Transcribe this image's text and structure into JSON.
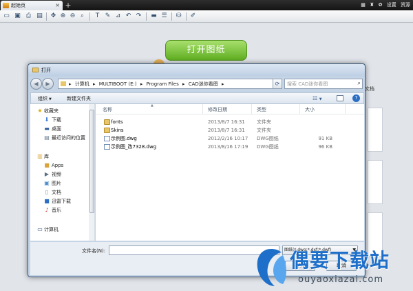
{
  "tabs": [
    {
      "label": "起始页",
      "close": "×"
    }
  ],
  "tab_add": "+",
  "topbar": {
    "settings": "设置",
    "resources": "资源"
  },
  "toolbar": {
    "icons": [
      "open-file-icon",
      "save-icon",
      "print-icon",
      "print-preview-icon",
      "zoom-realtime-icon",
      "zoom-in-icon",
      "zoom-out-icon",
      "zoom-extents-icon",
      "text-icon",
      "pen-icon",
      "measure-icon",
      "undo-icon",
      "redo-icon",
      "layer-icon",
      "layers-icon",
      "layer-manager-icon",
      "paint-icon"
    ]
  },
  "workspace": {
    "open_drawing": "打开图纸",
    "recent_doc": "文档"
  },
  "dialog": {
    "title": "打开",
    "back": "◀",
    "forward": "▶",
    "path": [
      "计算机",
      "MULTIBOOT (E:)",
      "Program Files",
      "CAD迷你看图"
    ],
    "search_placeholder": "搜索 CAD迷你看图",
    "organize": "组织",
    "new_folder": "新建文件夹",
    "help": "?",
    "nav": {
      "favorites": "收藏夹",
      "favorites_items": [
        "下载",
        "桌面",
        "最近访问的位置"
      ],
      "library": "库",
      "library_items": [
        "Apps",
        "视频",
        "图片",
        "文档",
        "迅雷下载",
        "音乐"
      ],
      "computer": "计算机"
    },
    "columns": {
      "name": "名称",
      "date": "修改日期",
      "type": "类型",
      "size": "大小"
    },
    "files": [
      {
        "name": "fonts",
        "date": "2013/8/7 16:31",
        "type": "文件夹",
        "size": "",
        "kind": "folder"
      },
      {
        "name": "Skins",
        "date": "2013/8/7 16:31",
        "type": "文件夹",
        "size": "",
        "kind": "folder"
      },
      {
        "name": "示例图.dwg",
        "date": "2012/2/16 10:17",
        "type": "DWG图纸",
        "size": "91 KB",
        "kind": "dwg"
      },
      {
        "name": "示例图_改7328.dwg",
        "date": "2013/8/16 17:19",
        "type": "DWG图纸",
        "size": "96 KB",
        "kind": "dwg"
      }
    ],
    "filename_label": "文件名(N):",
    "filename_value": "",
    "filetype": "图纸(*.dwg;*.dxf;*.dwf)",
    "open": "打开",
    "cancel": "取消"
  },
  "watermark": {
    "title": "偶要下载站",
    "url": "ouyaoxiazai.com"
  }
}
